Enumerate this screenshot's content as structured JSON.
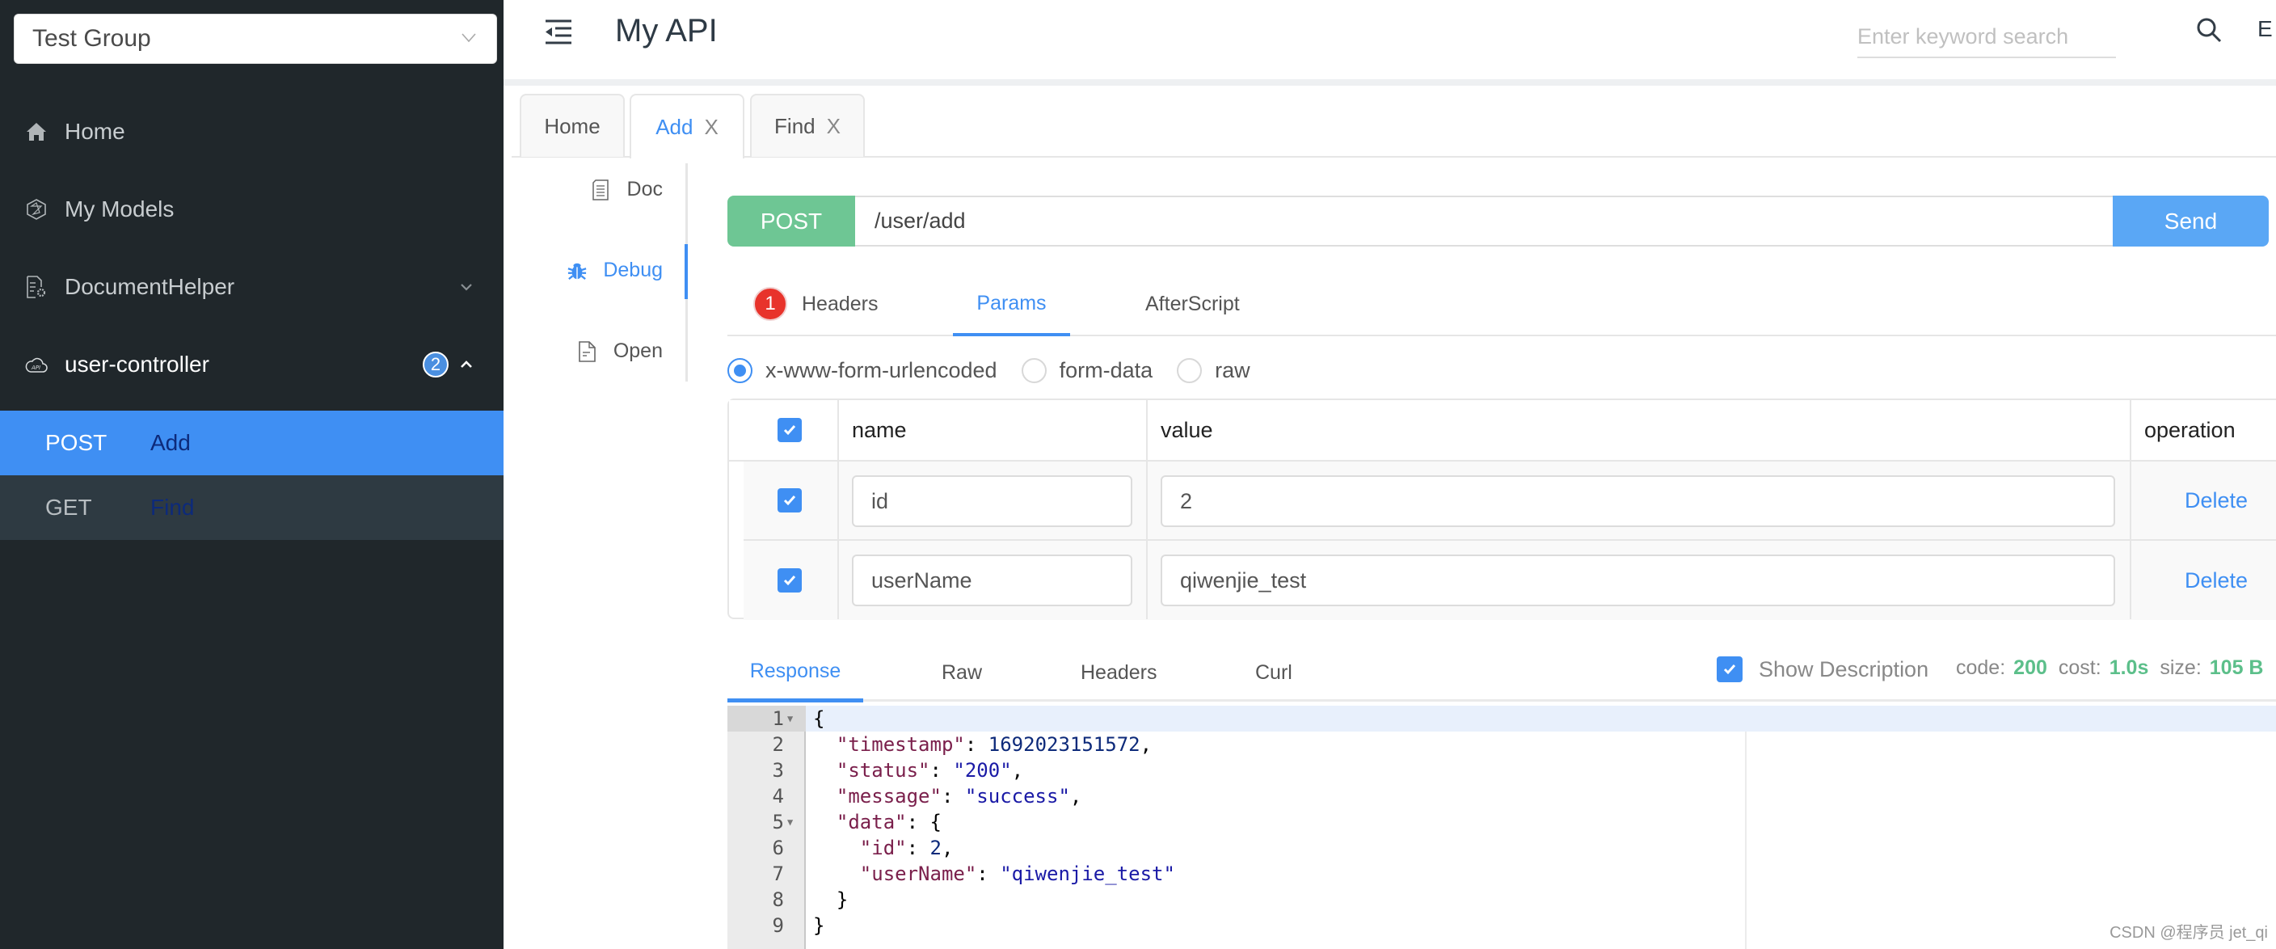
{
  "sidebar": {
    "group_select": {
      "value": "Test Group"
    },
    "items": [
      {
        "label": "Home",
        "icon": "home-icon"
      },
      {
        "label": "My Models",
        "icon": "models-icon"
      },
      {
        "label": "DocumentHelper",
        "icon": "document-settings-icon",
        "expanded": false
      },
      {
        "label": "user-controller",
        "icon": "cloud-api-icon",
        "badge": "2",
        "expanded": true
      }
    ],
    "sub_items": [
      {
        "method": "POST",
        "name": "Add",
        "active": true
      },
      {
        "method": "GET",
        "name": "Find",
        "active": false
      }
    ]
  },
  "header": {
    "title": "My API",
    "search_placeholder": "Enter keyword search",
    "lang_button": "E"
  },
  "page_tabs": [
    {
      "label": "Home",
      "closable": false,
      "active": false
    },
    {
      "label": "Add",
      "closable": true,
      "active": true,
      "close": "X"
    },
    {
      "label": "Find",
      "closable": true,
      "active": false,
      "close": "X"
    }
  ],
  "subnav": [
    {
      "label": "Doc",
      "icon": "document-icon",
      "active": false
    },
    {
      "label": "Debug",
      "icon": "bug-icon",
      "active": true
    },
    {
      "label": "Open",
      "icon": "file-icon",
      "active": false
    }
  ],
  "request": {
    "method": "POST",
    "url": "/user/add",
    "send_label": "Send",
    "tabs": [
      {
        "label": "Headers",
        "badge": "1",
        "active": false
      },
      {
        "label": "Params",
        "active": true
      },
      {
        "label": "AfterScript",
        "active": false
      }
    ],
    "body_types": [
      {
        "label": "x-www-form-urlencoded",
        "checked": true
      },
      {
        "label": "form-data",
        "checked": false
      },
      {
        "label": "raw",
        "checked": false
      }
    ],
    "params_table": {
      "columns": [
        "name",
        "value",
        "operation"
      ],
      "rows": [
        {
          "checked": true,
          "name": "id",
          "value": "2",
          "action": "Delete"
        },
        {
          "checked": true,
          "name": "userName",
          "value": "qiwenjie_test",
          "action": "Delete"
        }
      ]
    }
  },
  "response": {
    "tabs": [
      {
        "label": "Response",
        "active": true
      },
      {
        "label": "Raw",
        "active": false
      },
      {
        "label": "Headers",
        "active": false
      },
      {
        "label": "Curl",
        "active": false
      }
    ],
    "show_description": {
      "label": "Show Description",
      "checked": true
    },
    "stats": {
      "code_label": "code:",
      "code": "200",
      "cost_label": "cost:",
      "cost": "1.0s",
      "size_label": "size:",
      "size": "105 B"
    },
    "body_lines": [
      {
        "n": "1",
        "fold": true
      },
      {
        "n": "2"
      },
      {
        "n": "3"
      },
      {
        "n": "4"
      },
      {
        "n": "5",
        "fold": true
      },
      {
        "n": "6"
      },
      {
        "n": "7"
      },
      {
        "n": "8"
      },
      {
        "n": "9"
      }
    ],
    "body": {
      "timestamp": "1692023151572",
      "status": "\"200\"",
      "message": "\"success\"",
      "data_id": "2",
      "data_userName": "\"qiwenjie_test\""
    }
  },
  "colors": {
    "sidebar_bg": "#20272b",
    "accent": "#3f8ff3",
    "method_post": "#6ec694",
    "send_button": "#5aa7f5",
    "status_green": "#5cbf8a",
    "badge_red": "#e8332b"
  },
  "watermark": "CSDN @程序员 jet_qi"
}
